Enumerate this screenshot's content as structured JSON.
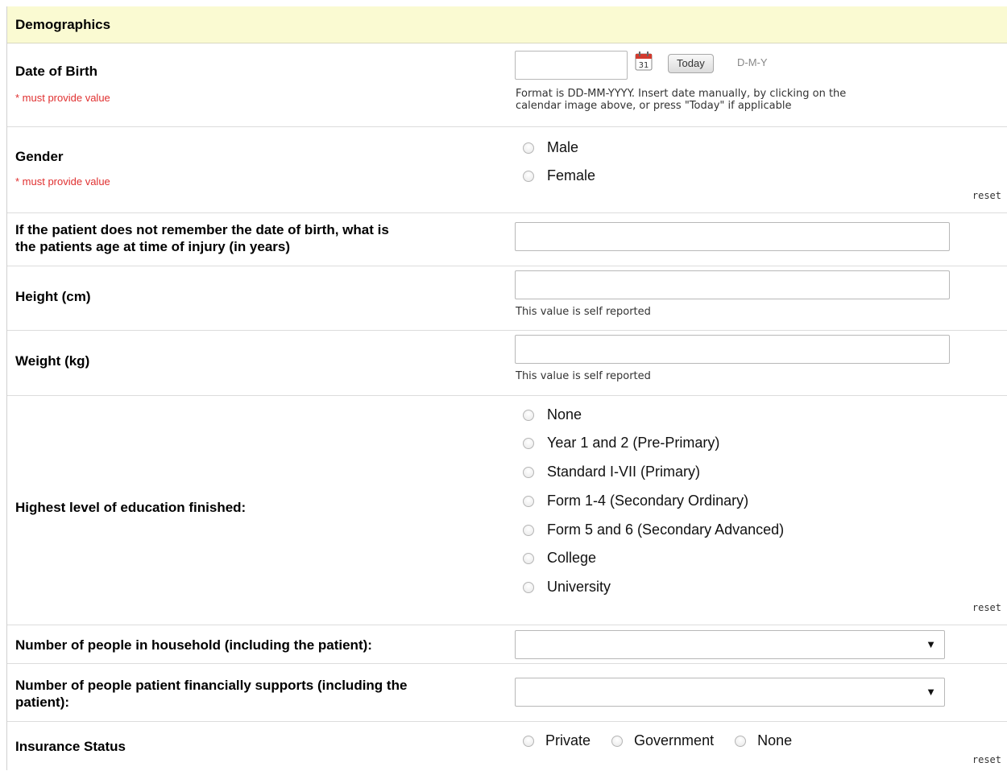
{
  "section": {
    "title": "Demographics"
  },
  "dob": {
    "label": "Date of Birth",
    "required": "* must provide value",
    "today_label": "Today",
    "format_hint": "D-M-Y",
    "note_line1": "Format is DD-MM-YYYY. Insert date manually, by clicking on the",
    "note_line2": "calendar image above, or press \"Today\" if applicable",
    "calendar_day": "31"
  },
  "gender": {
    "label": "Gender",
    "required": "* must provide value",
    "options": [
      "Male",
      "Female"
    ],
    "reset": "reset"
  },
  "age": {
    "label_line1": "If the patient does not remember the date of birth, what is",
    "label_line2": "the patients age at time of injury (in years)"
  },
  "height": {
    "label": "Height (cm)",
    "note": "This value is self reported"
  },
  "weight": {
    "label": "Weight (kg)",
    "note": "This value is self reported"
  },
  "education": {
    "label": "Highest level of education finished:",
    "options": [
      "None",
      "Year 1 and 2 (Pre-Primary)",
      "Standard I-VII (Primary)",
      "Form 1-4 (Secondary Ordinary)",
      "Form 5 and 6 (Secondary Advanced)",
      "College",
      "University"
    ],
    "reset": "reset"
  },
  "household": {
    "label": "Number of people in household (including the patient):",
    "selected": ""
  },
  "supports": {
    "label_line1": "Number of people patient financially supports (including the",
    "label_line2": "patient):",
    "selected": ""
  },
  "insurance": {
    "label": "Insurance Status",
    "options": [
      "Private",
      "Government",
      "None"
    ],
    "reset": "reset"
  }
}
